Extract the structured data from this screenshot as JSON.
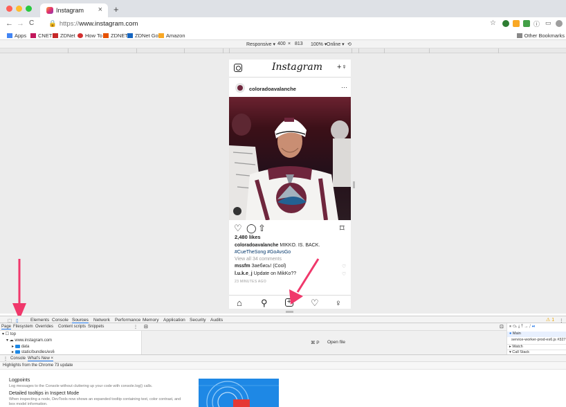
{
  "browser": {
    "tab_title": "Instagram",
    "tab_close": "×",
    "new_tab": "+",
    "nav": {
      "back": "←",
      "forward": "→",
      "reload": "C",
      "url_prefix": "https://",
      "url_host": "www.instagram.com"
    },
    "bookmarks": [
      {
        "label": "Apps",
        "color": "#4285f4"
      },
      {
        "label": "CNET",
        "color": "#c2185b"
      },
      {
        "label": "ZDNet",
        "color": "#c62828"
      },
      {
        "label": "How To",
        "color": "#d32f2f"
      },
      {
        "label": "ZDNET",
        "color": "#e65100"
      },
      {
        "label": "ZDNet Got",
        "color": "#1565c0"
      },
      {
        "label": "Amazon",
        "color": "#f9a825"
      }
    ],
    "other_bookmarks": "Other Bookmarks"
  },
  "device_toolbar": {
    "mode": "Responsive ▾",
    "width": "400",
    "times": "×",
    "height": "813",
    "zoom": "100% ▾",
    "network": "Online ▾",
    "rotate": "⟲"
  },
  "instagram": {
    "logo": "Instagram",
    "add_person": "+♀",
    "post_user": "coloradoavalanche",
    "more": "···",
    "likes": "2,480 likes",
    "caption_user": "coloradoavalanche",
    "caption_text": " MIKKO. IS. BACK. ",
    "caption_tags": "#CueTheSong #GoAvsGo",
    "view_all": "View all 34 comments",
    "comments": [
      {
        "user": "mssfm",
        "text": " Заебись! (Cool)"
      },
      {
        "user": "l.u.k.e_j",
        "text": " Update on MikKo??"
      }
    ],
    "time_ago": "23 MINUTES AGO"
  },
  "devtools": {
    "tabs": [
      "Elements",
      "Console",
      "Sources",
      "Network",
      "Performance",
      "Memory",
      "Application",
      "Security",
      "Audits"
    ],
    "active_tab": "Sources",
    "warning": "⚠ 1",
    "sub_tabs": [
      "Page",
      "Filesystem",
      "Overrides",
      "Content scripts",
      "Snippets"
    ],
    "tree": {
      "top": "top",
      "host": "www.instagram.com",
      "folder1": "data",
      "folder2": "static/bundles/es6"
    },
    "shortcut": "⌘ P",
    "open_file": "Open file",
    "right_panel": {
      "main": "Main",
      "worker": "service-worker-prod-es6.js #327",
      "watch": "Watch",
      "callstack": "Call Stack"
    },
    "drawer_tabs": [
      "Console",
      "What's New ×"
    ],
    "highlights": "Highlights from the Chrome 73 update",
    "whats_new": [
      {
        "title": "Logpoints",
        "desc": "Log messages to the Console without cluttering up your code with console.log() calls."
      },
      {
        "title": "Detailed tooltips in Inspect Mode",
        "desc": "When inspecting a node, DevTools now shows an expanded tooltip containing text, color contrast, and box model information."
      }
    ]
  },
  "colors": {
    "arrow": "#f0386b",
    "accent": "#1a73e8",
    "avalanche": "#6f263d"
  }
}
